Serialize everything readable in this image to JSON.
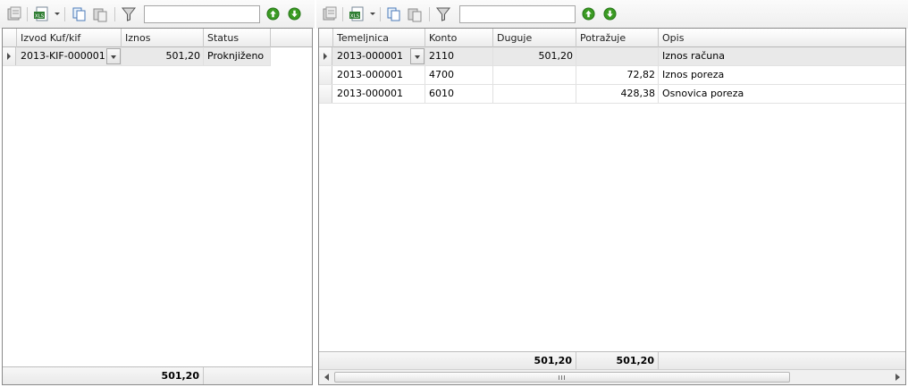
{
  "left": {
    "columns": [
      "Izvod Kuf/kif",
      "Iznos",
      "Status"
    ],
    "rows": [
      {
        "izvod": "2013-KIF-000001",
        "iznos": "501,20",
        "status": "Proknjiženo"
      }
    ],
    "footer_total": "501,20",
    "search_value": ""
  },
  "right": {
    "columns": [
      "Temeljnica",
      "Konto",
      "Duguje",
      "Potražuje",
      "Opis"
    ],
    "rows": [
      {
        "temeljnica": "2013-000001",
        "konto": "2110",
        "duguje": "501,20",
        "potrazuje": "",
        "opis": "Iznos računa"
      },
      {
        "temeljnica": "2013-000001",
        "konto": "4700",
        "duguje": "",
        "potrazuje": "72,82",
        "opis": "Iznos poreza"
      },
      {
        "temeljnica": "2013-000001",
        "konto": "6010",
        "duguje": "",
        "potrazuje": "428,38",
        "opis": "Osnovica poreza"
      }
    ],
    "footer_duguje": "501,20",
    "footer_potrazuje": "501,20",
    "search_value": ""
  },
  "toolbar_icons": [
    "grid-options-icon",
    "excel-export-icon",
    "copy-icon",
    "paste-icon",
    "filter-icon",
    "move-up-icon",
    "move-down-icon"
  ],
  "colors": {
    "nav_green": "#3a9a22",
    "selected_row": "#e9e9e9"
  }
}
